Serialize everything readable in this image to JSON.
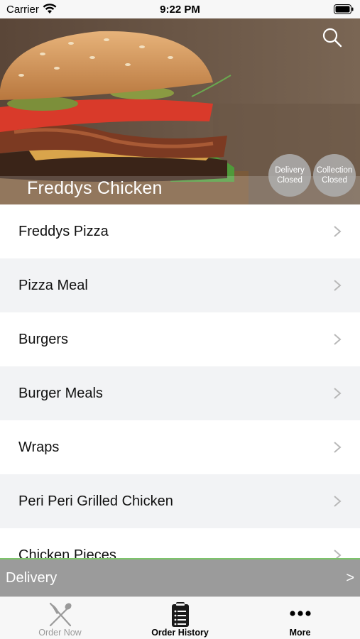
{
  "status_bar": {
    "carrier": "Carrier",
    "time": "9:22 PM"
  },
  "hero": {
    "restaurant_name": "Freddys Chicken",
    "search_icon": "search-icon",
    "delivery_status": {
      "line1": "Delivery",
      "line2": "Closed"
    },
    "collection_status": {
      "line1": "Collection",
      "line2": "Closed"
    }
  },
  "menu": {
    "categories": [
      "Freddys Pizza",
      "Pizza Meal",
      "Burgers",
      "Burger Meals",
      "Wraps",
      "Peri Peri Grilled Chicken",
      "Chicken Pieces"
    ],
    "row_icon": "chevron-right-icon"
  },
  "delivery_bar": {
    "label": "Delivery",
    "arrow": ">"
  },
  "tab_bar": {
    "tabs": [
      {
        "label": "Order Now",
        "icon": "fork-knife-icon",
        "active": false
      },
      {
        "label": "Order History",
        "icon": "clipboard-list-icon",
        "active": true
      },
      {
        "label": "More",
        "icon": "more-dots-icon",
        "active": true
      }
    ]
  },
  "colors": {
    "accent_green": "#7cc46a",
    "delivery_bar": "#9b9b9b",
    "row_alt": "#f2f3f5"
  }
}
